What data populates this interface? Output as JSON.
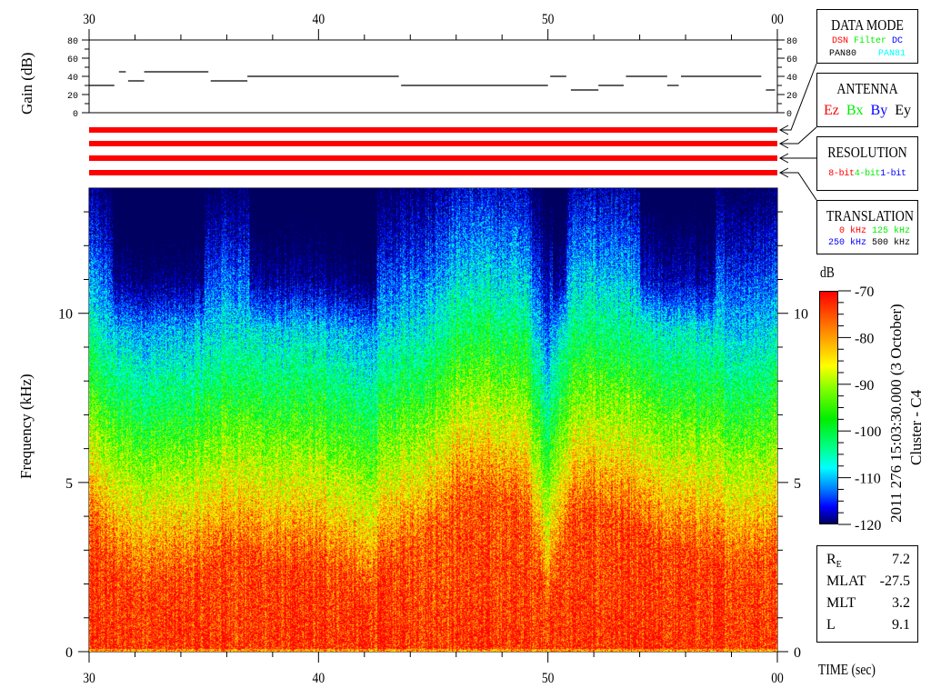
{
  "chart_data": {
    "type": "heatmap",
    "xlabel": "TIME (sec)",
    "x_ticks": [
      "30",
      "40",
      "50",
      "00"
    ],
    "x_range_sec": [
      30,
      60
    ],
    "ylabel": "Frequency (kHz)",
    "y_ticks": [
      "0",
      "5",
      "10"
    ],
    "y_range_khz": [
      0,
      13.7
    ],
    "colorbar": {
      "label": "dB",
      "range": [
        -120,
        -70
      ],
      "ticks": [
        "-70",
        "-80",
        "-90",
        "-100",
        "-110",
        "-120"
      ]
    },
    "red_band_top_khz": {
      "time_sec": [
        30,
        31,
        32,
        33,
        34,
        35,
        36,
        37,
        38,
        39,
        40,
        41,
        42,
        43,
        44,
        45,
        46,
        47,
        48,
        49,
        50,
        51,
        52,
        53,
        54,
        55,
        56,
        57,
        58,
        59,
        60
      ],
      "values": [
        3.5,
        2.5,
        2,
        2,
        2,
        2.3,
        3,
        2.8,
        2.5,
        2.5,
        2.5,
        2.3,
        1.5,
        2.5,
        3,
        3.5,
        4.5,
        4.5,
        4.5,
        4.2,
        1.2,
        4,
        4.2,
        4,
        3.5,
        3,
        3,
        2.8,
        2.5,
        2.5,
        3
      ]
    },
    "low_intensity_intervals_sec": [
      [
        31,
        35
      ],
      [
        37,
        42.5
      ],
      [
        50.2,
        50.8
      ],
      [
        54,
        57.3
      ]
    ],
    "gain": {
      "ylabel": "Gain (dB)",
      "y_ticks": [
        "80",
        "60",
        "40",
        "20",
        "0"
      ],
      "y_range": [
        0,
        80
      ],
      "segments": [
        [
          30,
          31.1,
          30
        ],
        [
          31.3,
          31.6,
          45
        ],
        [
          31.7,
          32.4,
          35
        ],
        [
          32.4,
          35.2,
          45
        ],
        [
          35.3,
          36.9,
          35
        ],
        [
          36.9,
          43.5,
          40
        ],
        [
          43.6,
          50.0,
          30
        ],
        [
          50.1,
          50.8,
          40
        ],
        [
          51.0,
          52.2,
          25
        ],
        [
          52.2,
          53.3,
          30
        ],
        [
          53.4,
          55.2,
          40
        ],
        [
          55.2,
          55.7,
          30
        ],
        [
          55.8,
          59.3,
          40
        ],
        [
          59.5,
          59.9,
          25
        ]
      ]
    },
    "status_bars": {
      "count": 4,
      "color": "#ff0000"
    }
  },
  "panels": {
    "data_mode": {
      "title": "DATA MODE",
      "items": [
        {
          "t": "DSN",
          "c": "#ff0000"
        },
        {
          "t": "Filter",
          "c": "#00ee00"
        },
        {
          "t": "DC",
          "c": "#0000ff"
        },
        {
          "t": "PAN80",
          "c": "#000000"
        },
        {
          "t": "PAN81",
          "c": "#00ffff"
        }
      ]
    },
    "antenna": {
      "title": "ANTENNA",
      "items": [
        {
          "t": "Ez",
          "c": "#ff0000"
        },
        {
          "t": "Bx",
          "c": "#00ee00"
        },
        {
          "t": "By",
          "c": "#0000ff"
        },
        {
          "t": "Ey",
          "c": "#000000"
        }
      ]
    },
    "resolution": {
      "title": "RESOLUTION",
      "items": [
        {
          "t": "8-bit",
          "c": "#ff0000"
        },
        {
          "t": "4-bit",
          "c": "#00ee00"
        },
        {
          "t": "1-bit",
          "c": "#0000ff"
        }
      ]
    },
    "translation": {
      "title": "TRANSLATION",
      "items": [
        {
          "t": "0 kHz",
          "c": "#ff0000"
        },
        {
          "t": "125 kHz",
          "c": "#00ee00"
        },
        {
          "t": "250 kHz",
          "c": "#0000ff"
        },
        {
          "t": "500 kHz",
          "c": "#000000"
        }
      ]
    }
  },
  "timestamp": "2011 276 15:03:30.000 (3 October)",
  "spacecraft": "Cluster - C4",
  "orbit": [
    {
      "k": "R",
      "sub": "E",
      "v": "7.2"
    },
    {
      "k": "MLAT",
      "sub": "",
      "v": "-27.5"
    },
    {
      "k": "MLT",
      "sub": "",
      "v": "3.2"
    },
    {
      "k": "L",
      "sub": "",
      "v": "9.1"
    }
  ]
}
